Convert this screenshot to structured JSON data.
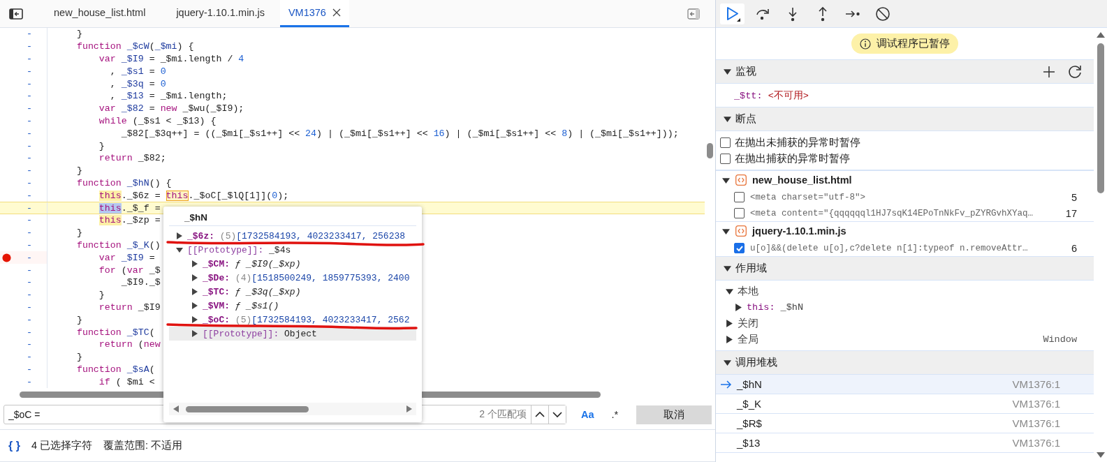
{
  "tabs": [
    {
      "label": "new_house_list.html",
      "selected": false,
      "closable": false
    },
    {
      "label": "jquery-1.10.1.min.js",
      "selected": false,
      "closable": false
    },
    {
      "label": "VM1376",
      "selected": true,
      "closable": true
    }
  ],
  "editor": {
    "lines": [
      {
        "gutter": "-",
        "breakpoint": false,
        "current": false,
        "segments": [
          {
            "text": "    }",
            "kind": "plain"
          }
        ]
      },
      {
        "gutter": "-",
        "breakpoint": false,
        "current": false,
        "segments": [
          {
            "text": "    function ",
            "kind": "keyword"
          },
          {
            "text": "_$cW",
            "kind": "def"
          },
          {
            "text": "(",
            "kind": "plain"
          },
          {
            "text": "_$mi",
            "kind": "def"
          },
          {
            "text": ") {",
            "kind": "plain"
          }
        ]
      },
      {
        "gutter": "-",
        "breakpoint": false,
        "current": false,
        "segments": [
          {
            "text": "        var ",
            "kind": "keyword"
          },
          {
            "text": "_$I9",
            "kind": "def"
          },
          {
            "text": " = _$mi.length / ",
            "kind": "plain"
          },
          {
            "text": "4",
            "kind": "number"
          }
        ]
      },
      {
        "gutter": "-",
        "breakpoint": false,
        "current": false,
        "segments": [
          {
            "text": "          , ",
            "kind": "plain"
          },
          {
            "text": "_$s1",
            "kind": "def"
          },
          {
            "text": " = ",
            "kind": "plain"
          },
          {
            "text": "0",
            "kind": "number"
          }
        ]
      },
      {
        "gutter": "-",
        "breakpoint": false,
        "current": false,
        "segments": [
          {
            "text": "          , ",
            "kind": "plain"
          },
          {
            "text": "_$3q",
            "kind": "def"
          },
          {
            "text": " = ",
            "kind": "plain"
          },
          {
            "text": "0",
            "kind": "number"
          }
        ]
      },
      {
        "gutter": "-",
        "breakpoint": false,
        "current": false,
        "segments": [
          {
            "text": "          , ",
            "kind": "plain"
          },
          {
            "text": "_$13",
            "kind": "def"
          },
          {
            "text": " = _$mi.length;",
            "kind": "plain"
          }
        ]
      },
      {
        "gutter": "-",
        "breakpoint": false,
        "current": false,
        "segments": [
          {
            "text": "        var ",
            "kind": "keyword"
          },
          {
            "text": "_$82",
            "kind": "def"
          },
          {
            "text": " = ",
            "kind": "plain"
          },
          {
            "text": "new",
            "kind": "keyword"
          },
          {
            "text": " _$wu(_$I9);",
            "kind": "plain"
          }
        ]
      },
      {
        "gutter": "-",
        "breakpoint": false,
        "current": false,
        "segments": [
          {
            "text": "        while",
            "kind": "keyword"
          },
          {
            "text": " (_$s1 < _$13) {",
            "kind": "plain"
          }
        ]
      },
      {
        "gutter": "-",
        "breakpoint": false,
        "current": false,
        "segments": [
          {
            "text": "            _$82[_$3q++] = ((_$mi[_$s1++] << ",
            "kind": "plain"
          },
          {
            "text": "24",
            "kind": "number"
          },
          {
            "text": ") | (_$mi[_$s1++] << ",
            "kind": "plain"
          },
          {
            "text": "16",
            "kind": "number"
          },
          {
            "text": ") | (_$mi[_$s1++] << ",
            "kind": "plain"
          },
          {
            "text": "8",
            "kind": "number"
          },
          {
            "text": ") | (_$mi[_$s1++]));",
            "kind": "plain"
          }
        ]
      },
      {
        "gutter": "-",
        "breakpoint": false,
        "current": false,
        "segments": [
          {
            "text": "        }",
            "kind": "plain"
          }
        ]
      },
      {
        "gutter": "-",
        "breakpoint": false,
        "current": false,
        "segments": [
          {
            "text": "        return",
            "kind": "keyword"
          },
          {
            "text": " _$82;",
            "kind": "plain"
          }
        ]
      },
      {
        "gutter": "-",
        "breakpoint": false,
        "current": false,
        "segments": [
          {
            "text": "    }",
            "kind": "plain"
          }
        ]
      },
      {
        "gutter": "-",
        "breakpoint": false,
        "current": false,
        "segments": [
          {
            "text": "    function ",
            "kind": "keyword"
          },
          {
            "text": "_$hN",
            "kind": "def"
          },
          {
            "text": "() {",
            "kind": "plain"
          }
        ]
      },
      {
        "gutter": "-",
        "breakpoint": false,
        "current": false,
        "segments": [
          {
            "text": "        this",
            "kind": "keyword-hover"
          },
          {
            "text": "._$6z = ",
            "kind": "plain"
          },
          {
            "text": "this",
            "kind": "keyword-boxed"
          },
          {
            "text": "._$oC[_$lQ[1]](",
            "kind": "plain"
          },
          {
            "text": "0",
            "kind": "number"
          },
          {
            "text": ");",
            "kind": "plain"
          }
        ]
      },
      {
        "gutter": "-",
        "breakpoint": false,
        "current": true,
        "segments": [
          {
            "text": "        this",
            "kind": "keyword-selected"
          },
          {
            "text": "._$_f =",
            "kind": "plain"
          }
        ]
      },
      {
        "gutter": "-",
        "breakpoint": false,
        "current": false,
        "segments": [
          {
            "text": "        this",
            "kind": "keyword-hover"
          },
          {
            "text": "._$zp =",
            "kind": "plain"
          }
        ]
      },
      {
        "gutter": "-",
        "breakpoint": false,
        "current": false,
        "segments": [
          {
            "text": "    }",
            "kind": "plain"
          }
        ]
      },
      {
        "gutter": "-",
        "breakpoint": false,
        "current": false,
        "segments": [
          {
            "text": "    function ",
            "kind": "keyword"
          },
          {
            "text": "_$_K",
            "kind": "def"
          },
          {
            "text": "()",
            "kind": "plain"
          }
        ]
      },
      {
        "gutter": "-",
        "breakpoint": true,
        "current": false,
        "segments": [
          {
            "text": "        var ",
            "kind": "keyword"
          },
          {
            "text": "_$I9",
            "kind": "def"
          },
          {
            "text": " =",
            "kind": "plain"
          }
        ]
      },
      {
        "gutter": "-",
        "breakpoint": false,
        "current": false,
        "segments": [
          {
            "text": "        for",
            "kind": "keyword"
          },
          {
            "text": " (",
            "kind": "plain"
          },
          {
            "text": "var",
            "kind": "keyword"
          },
          {
            "text": " _$",
            "kind": "plain"
          }
        ]
      },
      {
        "gutter": "-",
        "breakpoint": false,
        "current": false,
        "segments": [
          {
            "text": "            _$I9._$",
            "kind": "plain"
          }
        ]
      },
      {
        "gutter": "-",
        "breakpoint": false,
        "current": false,
        "segments": [
          {
            "text": "        }",
            "kind": "plain"
          }
        ]
      },
      {
        "gutter": "-",
        "breakpoint": false,
        "current": false,
        "segments": [
          {
            "text": "        return",
            "kind": "keyword"
          },
          {
            "text": " _$I9",
            "kind": "plain"
          }
        ]
      },
      {
        "gutter": "-",
        "breakpoint": false,
        "current": false,
        "segments": [
          {
            "text": "    }",
            "kind": "plain"
          }
        ]
      },
      {
        "gutter": "-",
        "breakpoint": false,
        "current": false,
        "segments": [
          {
            "text": "    function ",
            "kind": "keyword"
          },
          {
            "text": "_$TC",
            "kind": "def"
          },
          {
            "text": "(",
            "kind": "plain"
          }
        ]
      },
      {
        "gutter": "-",
        "breakpoint": false,
        "current": false,
        "segments": [
          {
            "text": "        return",
            "kind": "keyword"
          },
          {
            "text": " (",
            "kind": "plain"
          },
          {
            "text": "new",
            "kind": "keyword"
          }
        ]
      },
      {
        "gutter": "-",
        "breakpoint": false,
        "current": false,
        "segments": [
          {
            "text": "    }",
            "kind": "plain"
          }
        ]
      },
      {
        "gutter": "-",
        "breakpoint": false,
        "current": false,
        "segments": [
          {
            "text": "    function ",
            "kind": "keyword"
          },
          {
            "text": "_$sA",
            "kind": "def"
          },
          {
            "text": "(",
            "kind": "plain"
          }
        ]
      },
      {
        "gutter": "-",
        "breakpoint": false,
        "current": false,
        "segments": [
          {
            "text": "        if",
            "kind": "keyword"
          },
          {
            "text": " ( $mi <",
            "kind": "plain"
          }
        ]
      }
    ]
  },
  "popup": {
    "title": "_$hN",
    "rows": [
      {
        "key": "_$6z:",
        "internal": false,
        "expanded": false,
        "hovered": false,
        "kind": "array",
        "count": "(5)",
        "value": "[1732584193, 4023233417, 256238"
      },
      {
        "key": "[[Prototype]]:",
        "internal": true,
        "expanded": true,
        "hovered": false,
        "kind": "object",
        "value": "_$4s",
        "children": [
          {
            "key": "_$CM:",
            "internal": false,
            "expanded": false,
            "hovered": false,
            "kind": "function",
            "value": "ƒ _$I9(_$xp)"
          },
          {
            "key": "_$De:",
            "internal": false,
            "expanded": false,
            "hovered": false,
            "kind": "array",
            "count": "(4)",
            "value": "[1518500249, 1859775393, 2400"
          },
          {
            "key": "_$TC:",
            "internal": false,
            "expanded": false,
            "hovered": false,
            "kind": "function",
            "value": "ƒ _$3q(_$xp)"
          },
          {
            "key": "_$VM:",
            "internal": false,
            "expanded": false,
            "hovered": false,
            "kind": "function",
            "value": "ƒ _$s1()"
          },
          {
            "key": "_$oC:",
            "internal": false,
            "expanded": false,
            "hovered": false,
            "kind": "array",
            "count": "(5)",
            "value": "[1732584193, 4023233417, 2562"
          },
          {
            "key": "[[Prototype]]:",
            "internal": true,
            "expanded": false,
            "hovered": true,
            "kind": "object",
            "value": "Object"
          }
        ]
      }
    ]
  },
  "search": {
    "value": "_$oC =",
    "matches": "2 个匹配项",
    "options": [
      {
        "label": "Aa",
        "on": true
      },
      {
        "label": ".*",
        "on": false
      }
    ],
    "cancel": "取消"
  },
  "status_bar": {
    "icon": "{ }",
    "selection": "4 已选择字符",
    "coverage": "覆盖范围: 不适用"
  },
  "debugger": {
    "toolbar": [
      {
        "kind": "resume",
        "selected": true
      },
      {
        "kind": "step-over",
        "selected": false
      },
      {
        "kind": "step-into",
        "selected": false
      },
      {
        "kind": "step-out",
        "selected": false
      },
      {
        "kind": "step",
        "selected": false
      },
      {
        "kind": "deactivate",
        "selected": false
      }
    ],
    "banner": "调试程序已暂停",
    "watch": {
      "title": "监视",
      "expanded": true,
      "items": [
        {
          "name": "_$tt:",
          "value": "<不可用>"
        }
      ]
    },
    "breakpoints": {
      "title": "断点",
      "expanded": true,
      "options": [
        {
          "label": "在抛出未捕获的异常时暂停",
          "checked": false
        },
        {
          "label": "在抛出捕获的异常时暂停",
          "checked": false
        }
      ],
      "files": [
        {
          "name": "new_house_list.html",
          "expanded": true,
          "items": [
            {
              "code": "<meta charset=\"utf-8\">",
              "line": "5",
              "checked": false
            },
            {
              "code": "<meta content=\"{qqqqqql1HJ7sqK14EPoTnNkFv_pZYRGvhXYaq…",
              "line": "17",
              "checked": false
            }
          ]
        },
        {
          "name": "jquery-1.10.1.min.js",
          "expanded": true,
          "items": [
            {
              "code": "u[o]&&(delete u[o],c?delete n[1]:typeof n.removeAttr…",
              "line": "6",
              "checked": true
            }
          ]
        }
      ]
    },
    "scope": {
      "title": "作用域",
      "expanded": true,
      "groups": [
        {
          "label": "本地",
          "expanded": true,
          "children": [
            {
              "name": "this:",
              "value": "_$hN",
              "expanded": false
            }
          ]
        },
        {
          "label": "关闭",
          "expanded": false
        },
        {
          "label": "全局",
          "expanded": false,
          "value": "Window"
        }
      ]
    },
    "callstack": {
      "title": "调用堆栈",
      "expanded": true,
      "frames": [
        {
          "name": "_$hN",
          "location": "VM1376:1",
          "selected": true
        },
        {
          "name": "_$_K",
          "location": "VM1376:1",
          "selected": false
        },
        {
          "name": "_$R$",
          "location": "VM1376:1",
          "selected": false
        },
        {
          "name": "_$13",
          "location": "VM1376:1",
          "selected": false
        }
      ]
    }
  }
}
